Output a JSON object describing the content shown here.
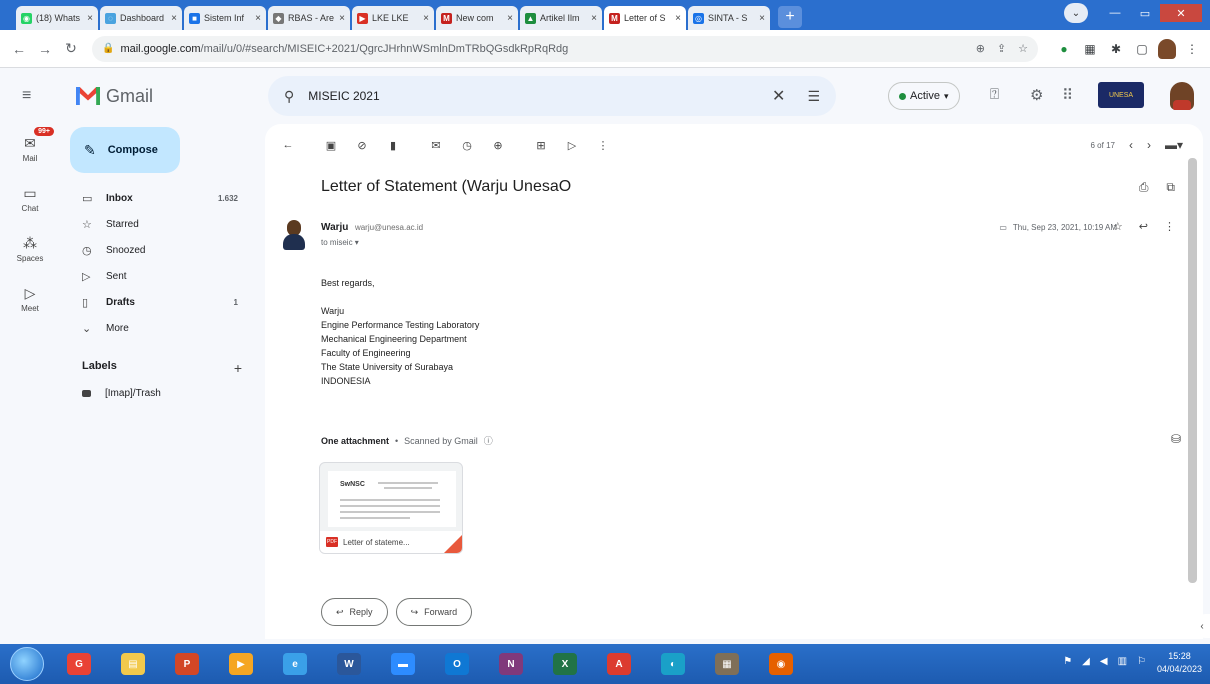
{
  "browser": {
    "tabs": [
      {
        "title": "(18) Whats",
        "color": "#25d366",
        "glyph": "◉"
      },
      {
        "title": "Dashboard",
        "color": "#4aa3df",
        "glyph": "◌"
      },
      {
        "title": "Sistem Inf",
        "color": "#1a73e8",
        "glyph": "■"
      },
      {
        "title": "RBAS - Are",
        "color": "#777777",
        "glyph": "◆"
      },
      {
        "title": "LKE LKE",
        "color": "#d93025",
        "glyph": "▶"
      },
      {
        "title": "New com",
        "color": "#c5221f",
        "glyph": "M"
      },
      {
        "title": "Artikel Ilm",
        "color": "#1e8e3e",
        "glyph": "▲"
      },
      {
        "title": "Letter of S",
        "color": "#c5221f",
        "glyph": "M",
        "active": true
      },
      {
        "title": "SINTA - S",
        "color": "#1a73e8",
        "glyph": "◎"
      }
    ],
    "tab_close": "×",
    "new_tab": "+",
    "url_host": "mail.google.com",
    "url_rest": "/mail/u/0/#search/MISEIC+2021/QgrcJHrhnWSmlnDmTRbQGsdkRpRqRdg"
  },
  "gmail": {
    "logo_text": "Gmail",
    "search_query": "MISEIC 2021",
    "status_label": "Active",
    "compose_label": "Compose",
    "rail": [
      {
        "label": "Mail",
        "badge": "99+"
      },
      {
        "label": "Chat"
      },
      {
        "label": "Spaces"
      },
      {
        "label": "Meet"
      }
    ],
    "nav": [
      {
        "label": "Inbox",
        "count": "1.632",
        "bold": true,
        "icon": "▭"
      },
      {
        "label": "Starred",
        "count": "",
        "icon": "☆"
      },
      {
        "label": "Snoozed",
        "count": "",
        "icon": "◷"
      },
      {
        "label": "Sent",
        "count": "",
        "icon": "▷"
      },
      {
        "label": "Drafts",
        "count": "1",
        "bold": true,
        "icon": "▯"
      },
      {
        "label": "More",
        "count": "",
        "icon": "⌄"
      }
    ],
    "labels_title": "Labels",
    "labels_add": "+",
    "labels": [
      {
        "label": "[Imap]/Trash"
      }
    ]
  },
  "email": {
    "pager": "6 of 17",
    "subject": "Letter of Statement (Warju UnesaO",
    "sender_name": "Warju",
    "sender_email": "warju@unesa.ac.id",
    "to_line": "to miseic",
    "date": "Thu, Sep 23, 2021, 10:19 AM",
    "greeting": "Best regards,",
    "signature": [
      "Warju",
      "Engine Performance Testing Laboratory",
      "Mechanical Engineering Department",
      "Faculty of Engineering",
      "The State University of Surabaya",
      "INDONESIA"
    ],
    "attachments_title": "One attachment",
    "scanned_text": "Scanned by Gmail",
    "attachment_name": "Letter of stateme...",
    "attachment_logo": "SwNSC",
    "reply_label": "Reply",
    "forward_label": "Forward"
  },
  "taskbar": {
    "clock_time": "15:28",
    "clock_date": "04/04/2023",
    "apps": [
      {
        "name": "chrome",
        "color": "#e94235",
        "glyph": "G"
      },
      {
        "name": "explorer",
        "color": "#f2c94c",
        "glyph": "▤"
      },
      {
        "name": "powerpoint",
        "color": "#d24726",
        "glyph": "P"
      },
      {
        "name": "media",
        "color": "#f5a623",
        "glyph": "▶"
      },
      {
        "name": "ie",
        "color": "#3aa0e8",
        "glyph": "e"
      },
      {
        "name": "word",
        "color": "#2b579a",
        "glyph": "W"
      },
      {
        "name": "zoom",
        "color": "#2d8cff",
        "glyph": "▬"
      },
      {
        "name": "outlook",
        "color": "#0f78d4",
        "glyph": "O"
      },
      {
        "name": "onenote",
        "color": "#80397b",
        "glyph": "N"
      },
      {
        "name": "excel",
        "color": "#217346",
        "glyph": "X"
      },
      {
        "name": "acrobat",
        "color": "#dc3b2f",
        "glyph": "A"
      },
      {
        "name": "edge",
        "color": "#1aa0c8",
        "glyph": "◐"
      },
      {
        "name": "calendar",
        "color": "#7f6f58",
        "glyph": "▦"
      },
      {
        "name": "firefox",
        "color": "#e66000",
        "glyph": "◉"
      }
    ]
  }
}
